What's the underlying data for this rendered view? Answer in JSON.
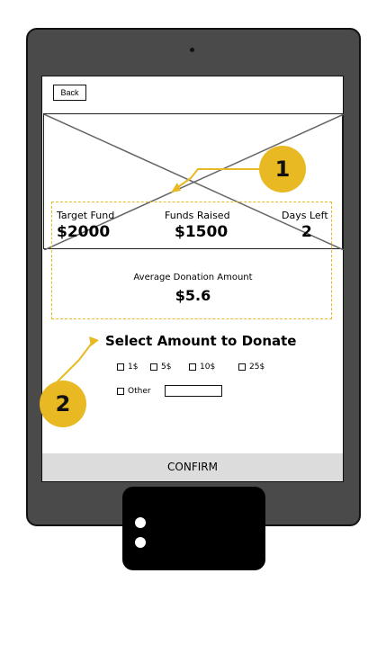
{
  "nav": {
    "back_label": "Back"
  },
  "stats": {
    "target_label": "Target Fund",
    "target_value": "$2000",
    "raised_label": "Funds Raised",
    "raised_value": "$1500",
    "days_label": "Days Left",
    "days_value": "2",
    "avg_label": "Average Donation Amount",
    "avg_value": "$5.6"
  },
  "donate": {
    "title": "Select Amount to Donate",
    "options": [
      "1$",
      "5$",
      "10$",
      "25$"
    ],
    "other_label": "Other"
  },
  "confirm_label": "CONFIRM",
  "annotations": {
    "badge_1": "1",
    "badge_2": "2"
  },
  "colors": {
    "accent": "#e8b923",
    "button_bg": "#dcdcdc",
    "tablet": "#4a4a4a"
  }
}
